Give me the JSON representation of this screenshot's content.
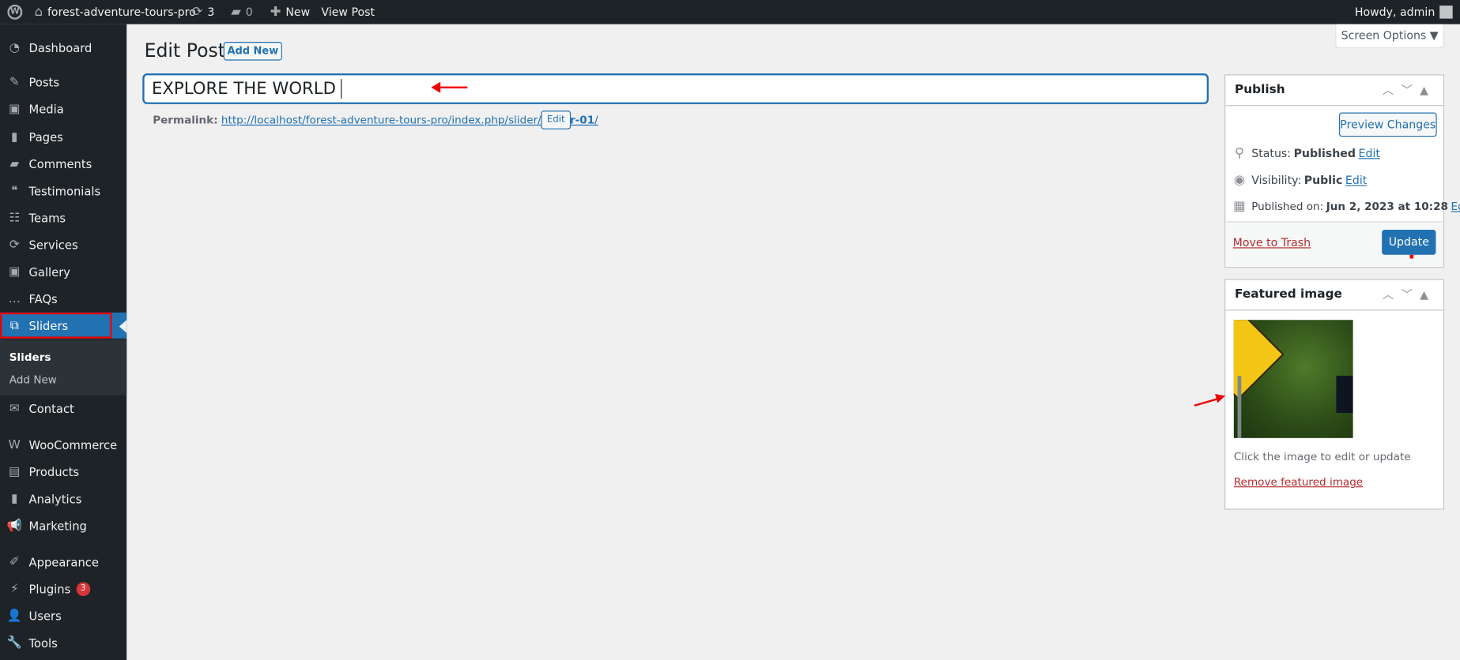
{
  "adminbar": {
    "site": "forest-adventure-tours-pro",
    "updates": "3",
    "comments": "0",
    "new": "New",
    "view_post": "View Post",
    "howdy": "Howdy, admin"
  },
  "sidebar": {
    "items": [
      {
        "label": "Dashboard",
        "icon": "dashboard-icon",
        "glyph": "◔"
      },
      {
        "label": "Posts",
        "icon": "pin-icon",
        "glyph": "✎"
      },
      {
        "label": "Media",
        "icon": "media-icon",
        "glyph": "▣"
      },
      {
        "label": "Pages",
        "icon": "pages-icon",
        "glyph": "▮"
      },
      {
        "label": "Comments",
        "icon": "comment-icon",
        "glyph": "▰"
      },
      {
        "label": "Testimonials",
        "icon": "testimonial-icon",
        "glyph": "❝"
      },
      {
        "label": "Teams",
        "icon": "groups-icon",
        "glyph": "☷"
      },
      {
        "label": "Services",
        "icon": "update-icon",
        "glyph": "⟳"
      },
      {
        "label": "Gallery",
        "icon": "gallery-icon",
        "glyph": "▣"
      },
      {
        "label": "FAQs",
        "icon": "faq-icon",
        "glyph": "…"
      },
      {
        "label": "Sliders",
        "icon": "slides-icon",
        "glyph": "⧉"
      },
      {
        "label": "Contact",
        "icon": "email-icon",
        "glyph": "✉"
      },
      {
        "label": "WooCommerce",
        "icon": "woo-icon",
        "glyph": "W"
      },
      {
        "label": "Products",
        "icon": "archive-icon",
        "glyph": "▤"
      },
      {
        "label": "Analytics",
        "icon": "chart-bar-icon",
        "glyph": "▮"
      },
      {
        "label": "Marketing",
        "icon": "megaphone-icon",
        "glyph": "📢"
      },
      {
        "label": "Appearance",
        "icon": "brush-icon",
        "glyph": "✐"
      },
      {
        "label": "Plugins",
        "icon": "plugin-icon",
        "glyph": "⚡",
        "badge": "3"
      },
      {
        "label": "Users",
        "icon": "user-icon",
        "glyph": "👤"
      },
      {
        "label": "Tools",
        "icon": "wrench-icon",
        "glyph": "🔧"
      }
    ],
    "submenu": [
      "Sliders",
      "Add New"
    ]
  },
  "header": {
    "title": "Edit Post",
    "add_new": "Add New",
    "screen_options": "Screen Options ▼"
  },
  "post": {
    "title": "EXPLORE THE WORLD",
    "permalink_label": "Permalink:",
    "permalink_base": "http://localhost/forest-adventure-tours-pro/index.php/slider/",
    "permalink_slug": "slider-01",
    "permalink_end": "/",
    "edit": "Edit"
  },
  "publish": {
    "title": "Publish",
    "preview": "Preview Changes",
    "status_label": "Status:",
    "status": "Published",
    "visibility_label": "Visibility:",
    "visibility": "Public",
    "published_label": "Published on:",
    "published": "Jun 2, 2023 at 10:28",
    "edit": "Edit",
    "trash": "Move to Trash",
    "update": "Update"
  },
  "featured": {
    "title": "Featured image",
    "hint": "Click the image to edit or update",
    "remove": "Remove featured image"
  },
  "colors": {
    "accent": "#2271b1",
    "sidebar": "#1d2327",
    "danger": "#b32d2e",
    "annotation": "#ee0000"
  }
}
